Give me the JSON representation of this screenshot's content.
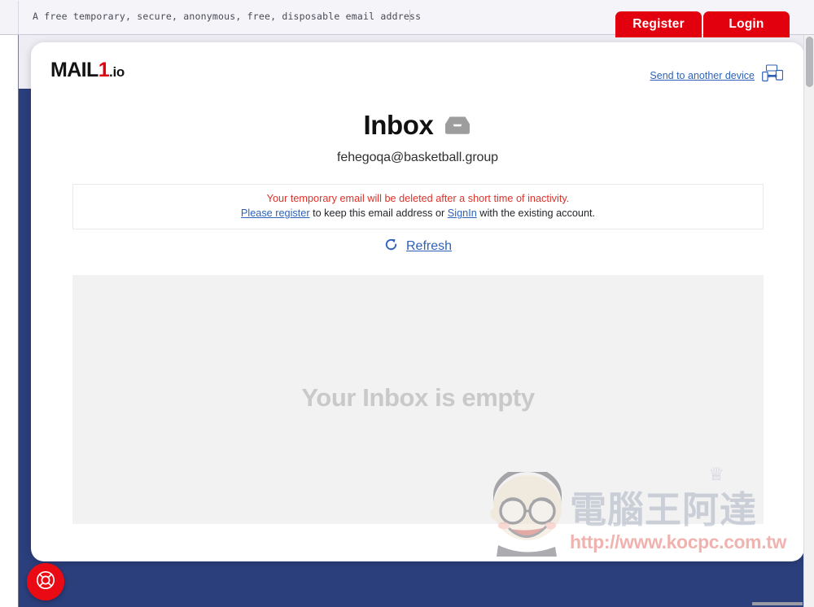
{
  "browser": {
    "extension_bar_text": "A free temporary, secure, anonymous, free, disposable email address"
  },
  "auth": {
    "register_label": "Register",
    "login_label": "Login"
  },
  "brand": {
    "logo_main": "MAIL",
    "logo_one": "1",
    "logo_tld": ".io"
  },
  "header": {
    "send_to_device_label": "Send to another device",
    "device_icon": "devices-sync-icon"
  },
  "inbox": {
    "title": "Inbox",
    "title_icon": "inbox-tray-icon",
    "email_address": "fehegoqa@basketball.group"
  },
  "notice": {
    "line1": "Your temporary email will be deleted after a short time of inactivity.",
    "register_link": "Please register",
    "middle_text": " to keep this email address or ",
    "signin_link": "SignIn",
    "trailing_text": " with the existing account."
  },
  "refresh": {
    "label": "Refresh",
    "icon": "refresh-circular-arrow-icon"
  },
  "empty_state": {
    "message": "Your Inbox is empty"
  },
  "watermark": {
    "chinese_text": "電腦王阿達",
    "url": "http://www.kocpc.com.tw"
  },
  "support": {
    "icon": "life-ring-icon"
  },
  "colors": {
    "brand_red": "#e2000f",
    "page_blue": "#2b3f7d",
    "link_blue": "#2d62b8",
    "warning_red": "#d9342b",
    "empty_gray": "#c9c9c9",
    "panel_gray": "#f2f2f2"
  }
}
